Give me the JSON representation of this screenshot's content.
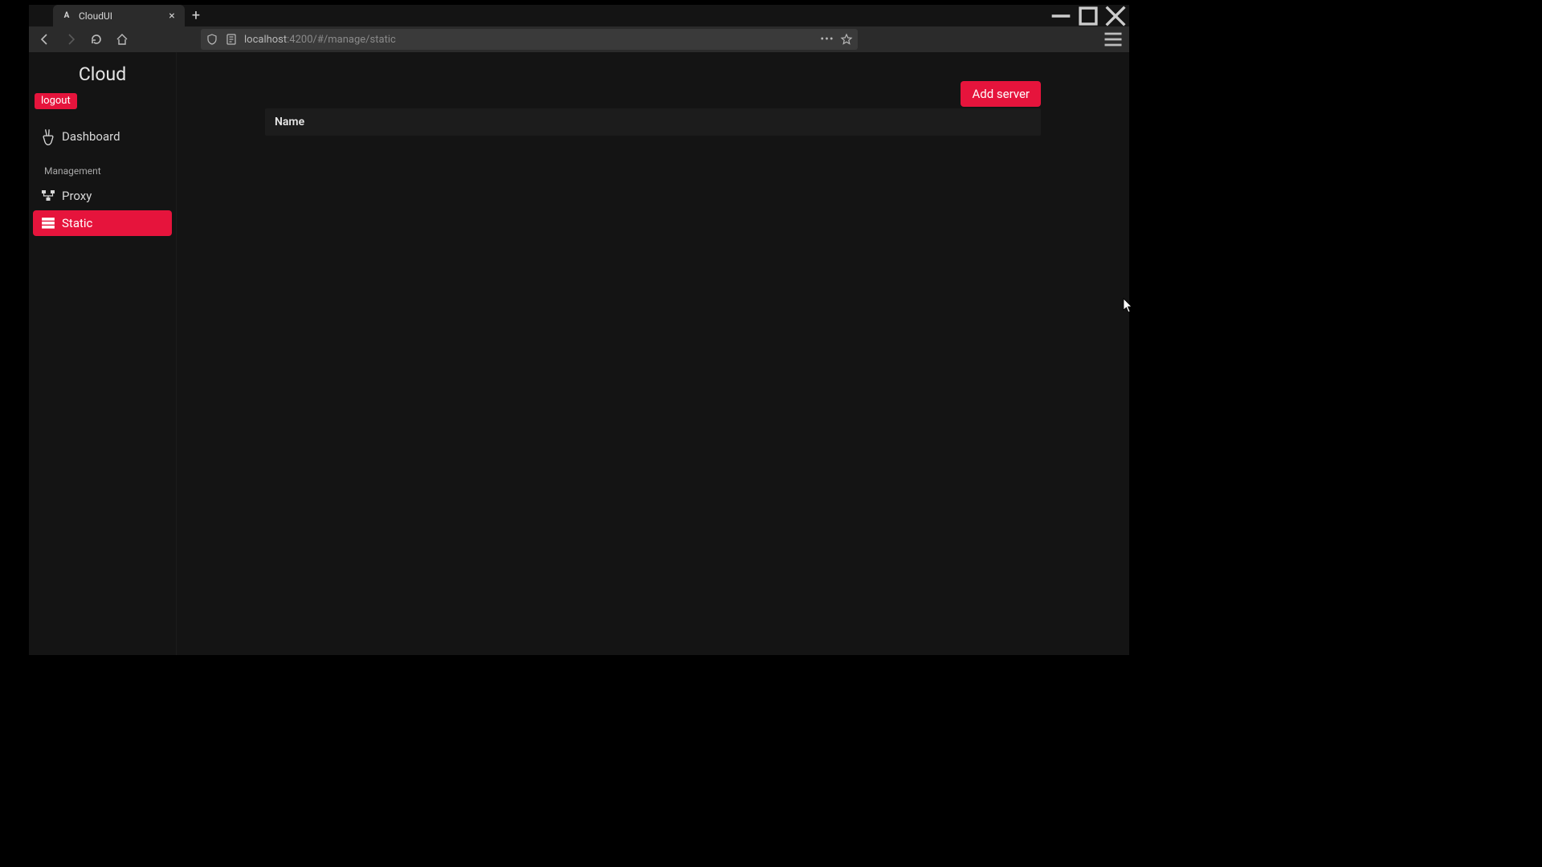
{
  "browser": {
    "tab_title": "CloudUI",
    "url_prefix": "localhost",
    "url_suffix": ":4200/#/manage/static"
  },
  "app": {
    "brand": "Cloud",
    "logout_label": "logout",
    "nav": {
      "dashboard": "Dashboard",
      "section_management": "Management",
      "proxy": "Proxy",
      "static": "Static"
    },
    "add_server_label": "Add server",
    "table": {
      "col_name": "Name"
    }
  }
}
